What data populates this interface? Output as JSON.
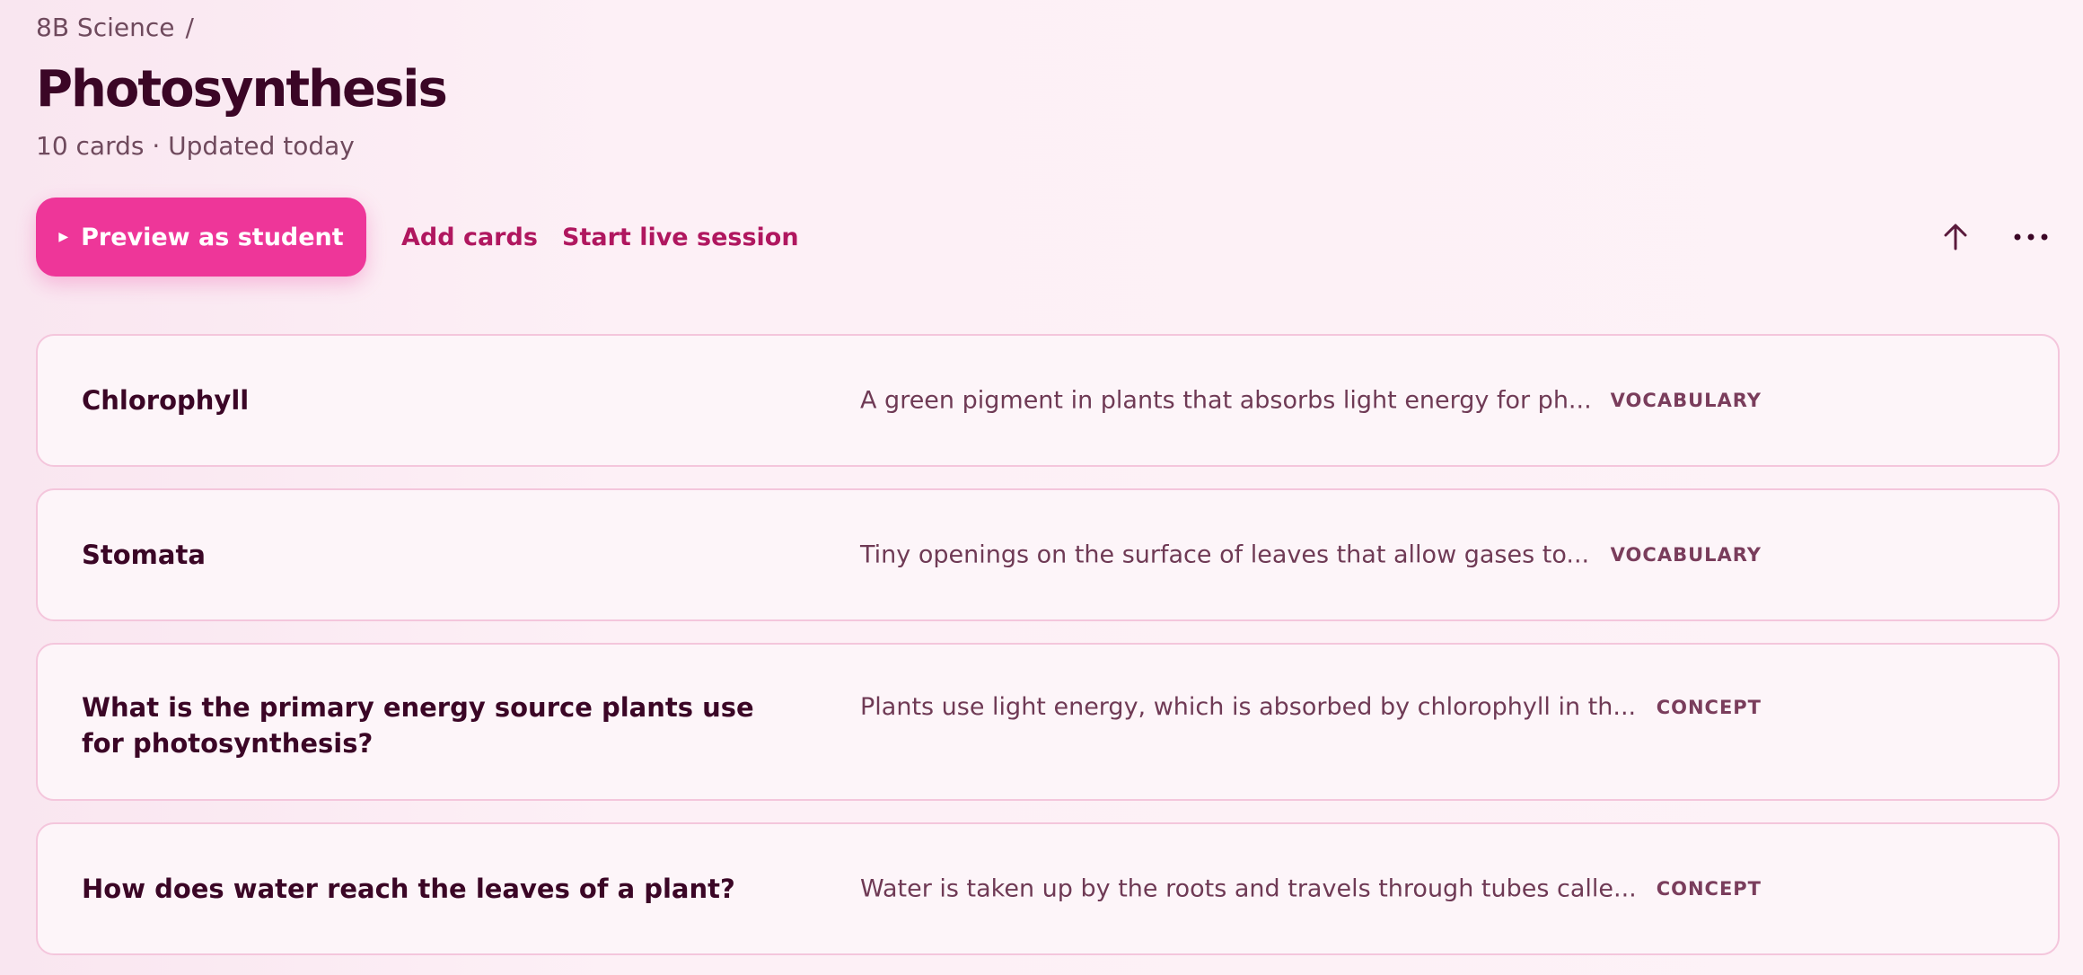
{
  "breadcrumb": {
    "parent": "8B Science",
    "separator": "/"
  },
  "deck": {
    "title": "Photosynthesis",
    "meta": "10 cards · Updated today"
  },
  "toolbar": {
    "preview_label": "Preview as student",
    "add_cards_label": "Add cards",
    "live_session_label": "Start live session",
    "share_icon": "arrow-up-icon",
    "more_icon": "more-horizontal-icon"
  },
  "colors": {
    "accent": "#ee3699",
    "link": "#b0175f",
    "heading": "#3b0626",
    "card_border": "#f4c6dc"
  },
  "cards": [
    {
      "term": "Chlorophyll",
      "definition": "A green pigment in plants that absorbs light energy for ph...",
      "tag": "VOCABULARY"
    },
    {
      "term": "Stomata",
      "definition": "Tiny openings on the surface of leaves that allow gases to...",
      "tag": "VOCABULARY"
    },
    {
      "term": "What is the primary energy source plants use for photosynthesis?",
      "definition": "Plants use light energy, which is absorbed by chlorophyll in th...",
      "tag": "CONCEPT"
    },
    {
      "term": "How does water reach the leaves of a plant?",
      "definition": "Water is taken up by the roots and travels through tubes calle...",
      "tag": "CONCEPT"
    }
  ]
}
